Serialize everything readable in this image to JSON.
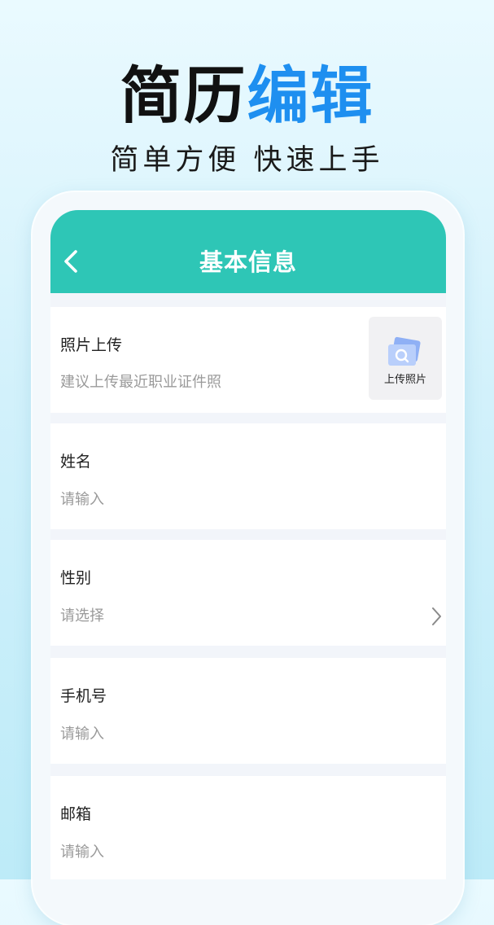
{
  "promo": {
    "title_dark": "简历",
    "title_blue": "编辑",
    "subtitle": "简单方便 快速上手"
  },
  "header": {
    "title": "基本信息"
  },
  "photo": {
    "label": "照片上传",
    "hint": "建议上传最近职业证件照",
    "upload_label": "上传照片"
  },
  "fields": [
    {
      "label": "姓名",
      "placeholder": "请输入"
    },
    {
      "label": "性别",
      "placeholder": "请选择"
    },
    {
      "label": "手机号",
      "placeholder": "请输入"
    },
    {
      "label": "邮箱",
      "placeholder": "请输入"
    }
  ],
  "colors": {
    "accent_teal": "#2ec6b6",
    "title_blue": "#1e8ff0"
  },
  "icons": {
    "back": "chevron-left-icon",
    "photo": "photo-upload-icon",
    "select": "chevron-right-icon"
  }
}
